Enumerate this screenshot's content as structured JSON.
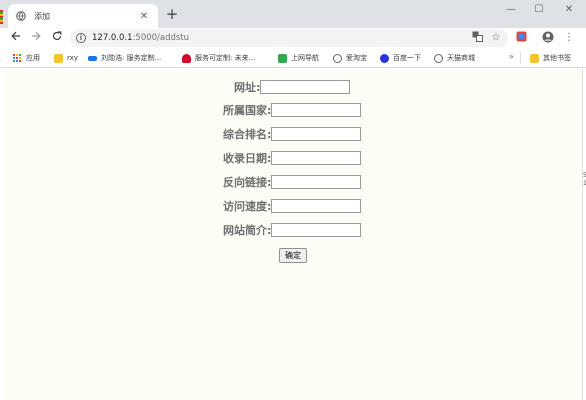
{
  "browser": {
    "tab": {
      "title": "添加",
      "favicon": "globe-icon"
    },
    "address": {
      "host": "127.0.0.1",
      "path": ":5000/addstu"
    },
    "bookmarks": [
      {
        "label": "应用",
        "icon": "apps-grid-icon"
      },
      {
        "label": "rxy",
        "icon": "folder-icon",
        "color": "#f4c430"
      },
      {
        "label": "刘勋浩: 服务定制...",
        "icon": "site-icon",
        "color": "#1a73e8"
      },
      {
        "label": "服务可定制: 未来...",
        "icon": "huawei-icon",
        "color": "#cf0a2c"
      },
      {
        "label": "上网导航",
        "icon": "nav-icon",
        "color": "#34a853"
      },
      {
        "label": "爱淘宝",
        "icon": "globe-icon",
        "color": "#5f6368"
      },
      {
        "label": "百度一下",
        "icon": "baidu-paw-icon",
        "color": "#2932e1"
      },
      {
        "label": "天猫商城",
        "icon": "globe-icon",
        "color": "#5f6368"
      }
    ],
    "bookmarks_overflow": "»",
    "other_bookmarks": "其他书签"
  },
  "form": {
    "fields": [
      {
        "label": "网址:",
        "value": ""
      },
      {
        "label": "所属国家:",
        "value": ""
      },
      {
        "label": "综合排名:",
        "value": ""
      },
      {
        "label": "收录日期:",
        "value": ""
      },
      {
        "label": "反向链接:",
        "value": ""
      },
      {
        "label": "访问速度:",
        "value": ""
      },
      {
        "label": "网站简介:",
        "value": ""
      }
    ],
    "submit_label": "确定"
  },
  "gutter_text": [
    "5",
    "1"
  ]
}
